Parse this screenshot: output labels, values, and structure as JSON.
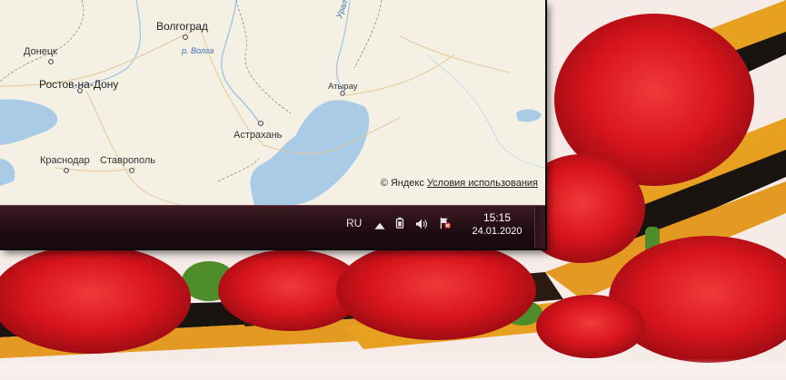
{
  "map": {
    "cities": [
      {
        "id": "volgograd",
        "name": "Волгоград"
      },
      {
        "id": "donetsk",
        "name": "Донецк"
      },
      {
        "id": "rostov",
        "name": "Ростов-на-Дону"
      },
      {
        "id": "atyrau",
        "name": "Атырау"
      },
      {
        "id": "astrakhan",
        "name": "Астрахань"
      },
      {
        "id": "krasnodar",
        "name": "Краснодар"
      },
      {
        "id": "stavropol",
        "name": "Ставрополь"
      }
    ],
    "rivers": {
      "volga": "р. Волга",
      "ural": "Урал"
    },
    "copyright": {
      "brand": "© Яндекс",
      "terms_link": "Условия использования"
    },
    "colors": {
      "land": "#f4f0e4",
      "water": "#a9cbe6",
      "border": "#6b6b6b"
    }
  },
  "taskbar": {
    "language": "RU",
    "tray_icons": [
      "show-hidden-icons-arrow",
      "power-icon",
      "volume-icon",
      "action-center-flag-icon"
    ],
    "clock": {
      "time": "15:15",
      "date": "24.01.2020"
    }
  }
}
